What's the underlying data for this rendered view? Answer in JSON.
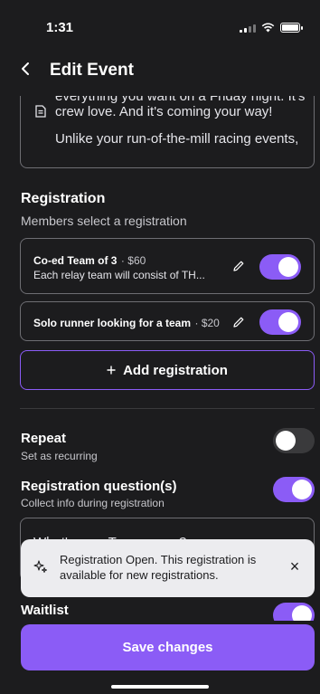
{
  "status_bar": {
    "time": "1:31",
    "icons": [
      "cellular-signal-icon",
      "wifi-icon",
      "battery-icon"
    ]
  },
  "nav": {
    "back_icon": "chevron-left-icon",
    "title": "Edit Event"
  },
  "description": {
    "icon": "document-icon",
    "line1": "everything you want on a Friday night. It's",
    "line2": "crew love. And it's coming your way!",
    "line3": "Unlike your run-of-the-mill racing events,"
  },
  "registration": {
    "title": "Registration",
    "subtitle": "Members select a registration",
    "items": [
      {
        "name": "Co-ed Team of 3",
        "price": "$60",
        "description": "Each relay team will consist of TH...",
        "enabled": true
      },
      {
        "name": "Solo runner looking for a team",
        "price": "$20",
        "enabled": true
      }
    ],
    "add_label": "Add registration",
    "add_icon": "plus-icon"
  },
  "options": {
    "repeat": {
      "title": "Repeat",
      "subtitle": "Set as recurring",
      "enabled": false
    },
    "questions": {
      "title": "Registration question(s)",
      "subtitle": "Collect info during registration",
      "enabled": true
    },
    "question_placeholder": "What's your Team name?",
    "waitlist": {
      "title": "Waitlist",
      "enabled": true
    }
  },
  "toast": {
    "icon": "sparkle-icon",
    "message": "Registration Open. This registration is available for new registrations.",
    "close_icon": "close-icon"
  },
  "footer": {
    "save_label": "Save changes"
  },
  "colors": {
    "background": "#1c1c1e",
    "accent": "#8b5cf6",
    "border": "#6e6e73",
    "toast_bg": "#ececef"
  }
}
